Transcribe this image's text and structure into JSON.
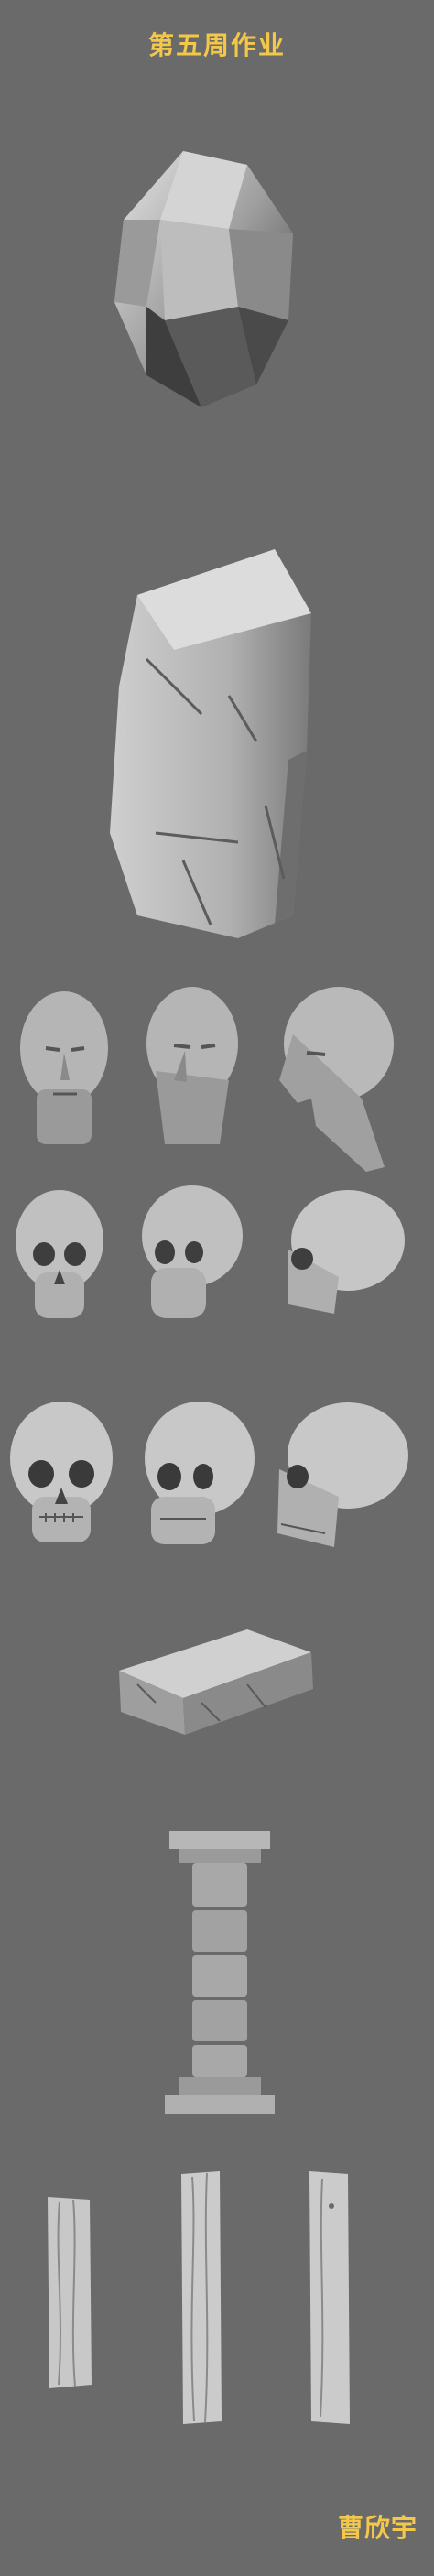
{
  "title": "第五周作业",
  "signature": "曹欣宇",
  "colors": {
    "background": "#6a6a6a",
    "text_accent": "#f2c74a",
    "clay_light": "#d9d9d9",
    "clay_mid": "#a9a9a9",
    "clay_dark": "#5a5a5a"
  },
  "icons": [
    "crystal-rock-sculpt",
    "cracked-stone-slab-sculpt",
    "head-sculpt",
    "skull-sculpt",
    "stone-brick-sculpt",
    "stone-pillar-sculpt",
    "wood-plank-sculpt"
  ]
}
